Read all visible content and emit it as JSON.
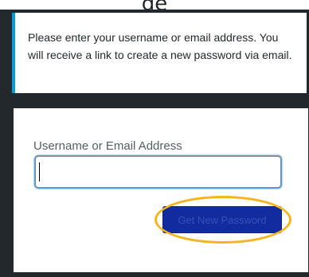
{
  "page": {
    "cut_heading": "...ge..."
  },
  "message": {
    "text": "Please enter your username or email address. You will receive a link to create a new password via email."
  },
  "form": {
    "field_label": "Username or Email Address",
    "field_value": "",
    "field_placeholder": "",
    "submit_label": "Get New Password"
  },
  "colors": {
    "frame": "#23282d",
    "message_accent": "#00a0d2",
    "button_bg": "#102c9e",
    "highlight": "#f6b31c"
  },
  "icons": {
    "highlight": "annotation-ellipse"
  }
}
